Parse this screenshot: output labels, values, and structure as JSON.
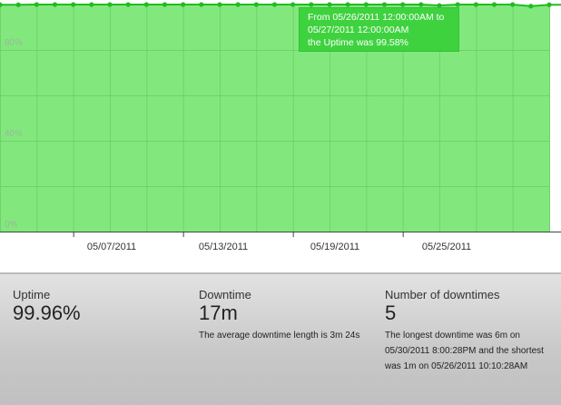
{
  "chart_data": {
    "type": "area",
    "title": "",
    "xlabel": "",
    "ylabel": "",
    "ylim": [
      0,
      100
    ],
    "grid": true,
    "fill_color": "#82e87e",
    "line_color": "#22bb22",
    "y_ticks": [
      "0%",
      "40%",
      "80%"
    ],
    "x_ticks": [
      "05/07/2011",
      "05/13/2011",
      "05/19/2011",
      "05/25/2011"
    ],
    "series": [
      {
        "values": [
          99.9,
          99.9,
          100,
          100,
          100,
          100,
          100,
          100,
          100,
          100,
          100,
          100,
          100,
          100,
          100,
          100,
          100,
          100,
          100,
          100,
          100,
          100,
          100,
          100,
          99.58,
          100,
          100,
          100,
          100,
          99.3,
          99.9
        ]
      }
    ]
  },
  "tooltip": {
    "line1": "From 05/26/2011 12:00:00AM to",
    "line2": "05/27/2011 12:00:00AM",
    "line3": "the Uptime was 99.58%"
  },
  "stats": {
    "uptime": {
      "label": "Uptime",
      "value": "99.96%"
    },
    "downtime": {
      "label": "Downtime",
      "value": "17m",
      "desc": "The average downtime length is 3m 24s"
    },
    "count": {
      "label": "Number of downtimes",
      "value": "5",
      "desc": "The longest downtime was 6m on 05/30/2011 8:00:28PM and the shortest was 1m on 05/26/2011 10:10:28AM"
    }
  }
}
